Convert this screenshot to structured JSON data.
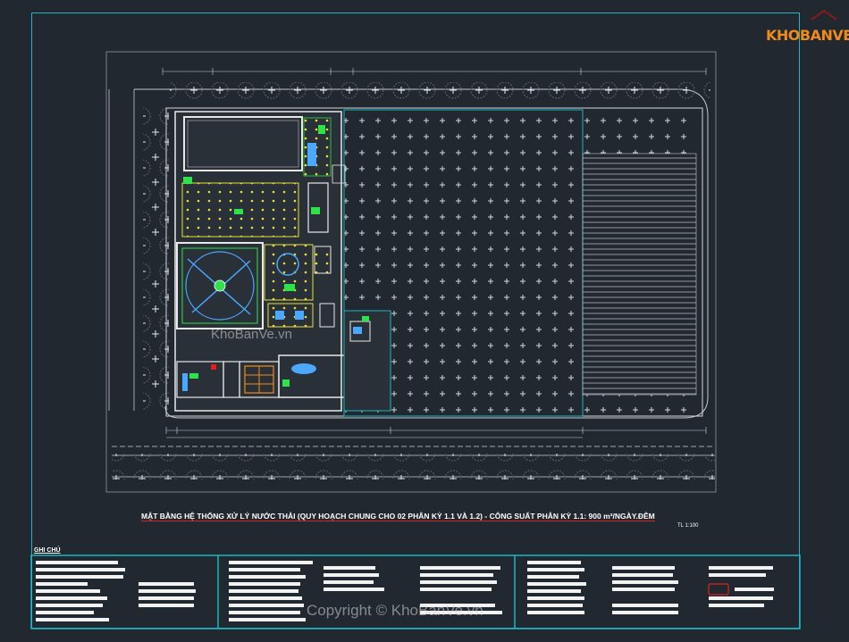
{
  "logo": {
    "text": "KHOBANVE"
  },
  "drawing": {
    "title": "MẶT BẰNG HỆ THỐNG XỬ LÝ NƯỚC THẢI (QUY HOẠCH CHUNG CHO 02 PHÂN KỲ 1.1 VÀ 1.2) - CÔNG SUẤT PHÂN KỲ 1.1: 900 m³/NGÀY.ĐÊM",
    "scale": "TL 1:100",
    "notes_title": "GHI CHÚ"
  },
  "watermarks": {
    "center": "KhoBanVe.vn",
    "bottom": "Copyright © KhoBanVe.vn"
  },
  "colors": {
    "background": "#212830",
    "frame": "#1fb5c4",
    "walls": "#ffffff",
    "green": "#2ee24a",
    "yellow": "#e8e03a",
    "blue": "#4aa8ff",
    "accent_red": "#e02020"
  }
}
